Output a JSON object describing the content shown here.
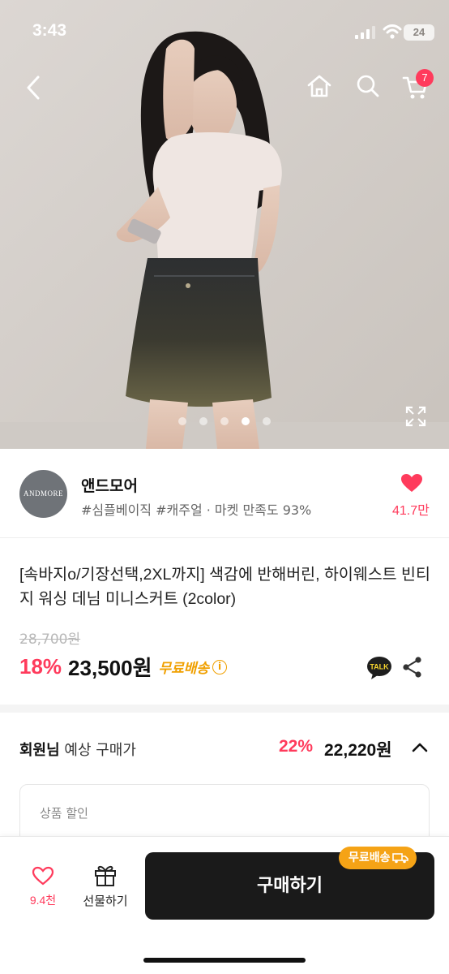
{
  "status_bar": {
    "time": "3:43",
    "battery": "24"
  },
  "nav": {
    "cart_count": "7"
  },
  "gallery": {
    "dot_count": 5,
    "active_index": 3
  },
  "seller": {
    "logo_text": "ANDMORE",
    "name": "앤드모어",
    "meta": "#심플베이직 #캐주얼 · 마켓 만족도 93%",
    "like_count": "41.7만"
  },
  "product": {
    "title": "[속바지o/기장선택,2XL까지] 색감에 반해버린, 하이웨스트 빈티지 워싱 데님 미니스커트 (2color)",
    "original_price": "28,700원",
    "discount": "18%",
    "price": "23,500원",
    "free_shipping": "무료배송",
    "info_icon": "i",
    "talk_label": "TALK"
  },
  "member": {
    "label_bold": "회원님",
    "label_rest": " 예상 구매가",
    "discount": "22%",
    "price": "22,220원"
  },
  "discount_section": {
    "label": "상품 할인"
  },
  "bottom_bar": {
    "wish_count": "9.4천",
    "gift_label": "선물하기",
    "buy_label": "구매하기",
    "buy_badge": "무료배송"
  },
  "colors": {
    "accent": "#ff3b5c",
    "free_shipping": "#f0a000",
    "buy_button": "#1a1a1a"
  }
}
